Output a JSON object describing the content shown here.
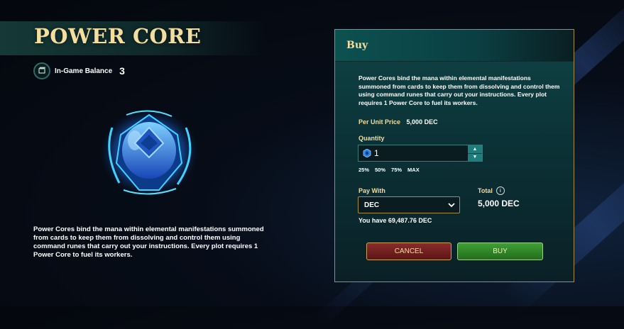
{
  "left": {
    "title": "POWER CORE",
    "balance_label": "In-Game Balance",
    "balance_value": "3",
    "description": "Power Cores bind the mana within elemental manifestations summoned from cards to keep them from dissolving and control them using command runes that carry out your instructions. Every plot requires 1 Power Core to fuel its workers."
  },
  "buy_panel": {
    "title": "Buy",
    "description": "Power Cores bind the mana within elemental manifestations summoned from cards to keep them from dissolving and control them using command runes that carry out your instructions. Every plot requires 1 Power Core to fuel its workers.",
    "unit_price_label": "Per Unit Price",
    "unit_price_value": "5,000 DEC",
    "quantity_label": "Quantity",
    "quantity_value": "1",
    "percent_options": [
      "25%",
      "50%",
      "75%",
      "MAX"
    ],
    "pay_with_label": "Pay With",
    "pay_with_selected": "DEC",
    "you_have": "You have 69,487.76 DEC",
    "total_label": "Total",
    "total_value": "5,000 DEC",
    "cancel_label": "CANCEL",
    "buy_label": "BUY"
  },
  "icons": {
    "balance": "power-core-badge-icon",
    "quantity": "power-core-small-icon",
    "info": "info-icon",
    "dropdown": "chevron-down-icon"
  },
  "colors": {
    "accent_gold": "#f3dea0",
    "panel_border": "#a98d3f",
    "cancel_bg": "#7a2222",
    "buy_bg": "#349029"
  }
}
